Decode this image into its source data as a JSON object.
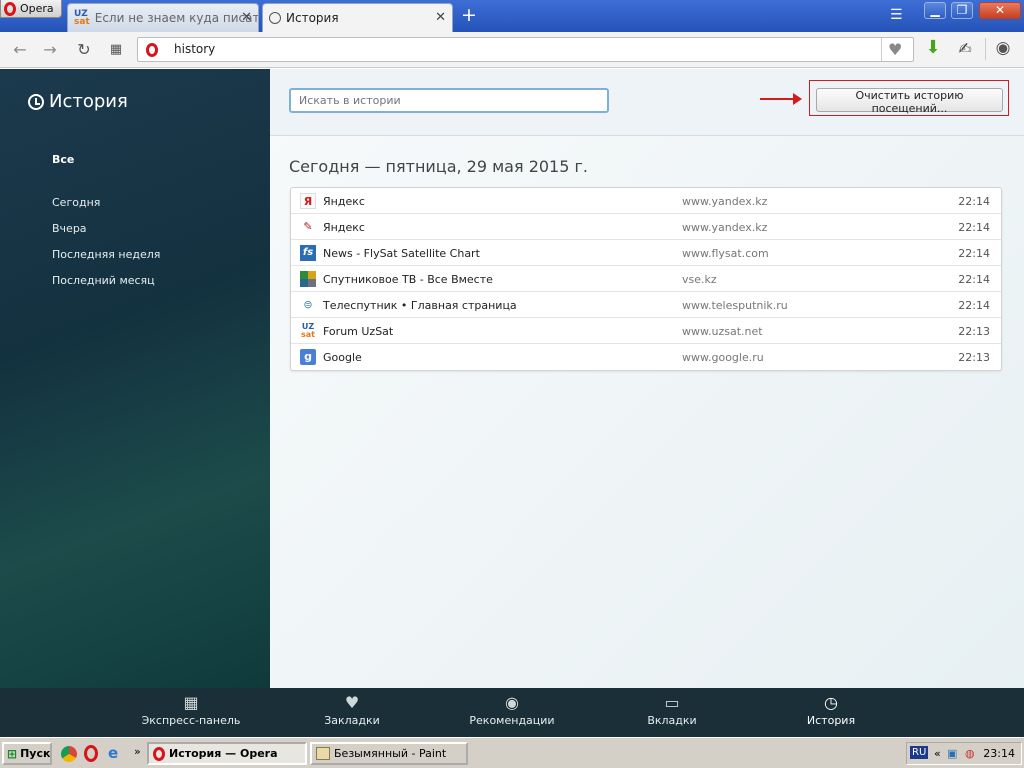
{
  "browser": {
    "menu_label": "Opera",
    "tabs": [
      {
        "title": "Если не знаем куда писать",
        "active": false
      },
      {
        "title": "История",
        "active": true
      }
    ],
    "new_tab": "+",
    "close_glyph": "✕",
    "window_buttons": {
      "minimize": "▁",
      "maximize": "❐",
      "close": "✕"
    }
  },
  "toolbar": {
    "address": "history",
    "icons": [
      "back-icon",
      "forward-icon",
      "reload-icon",
      "speed-dial-icon",
      "heart-icon",
      "download-icon",
      "extension-icon",
      "account-icon"
    ]
  },
  "sidebar": {
    "title": "История",
    "items": [
      {
        "label": "Все",
        "active": true
      },
      {
        "label": "Сегодня"
      },
      {
        "label": "Вчера"
      },
      {
        "label": "Последняя неделя"
      },
      {
        "label": "Последний месяц"
      }
    ]
  },
  "main": {
    "search_placeholder": "Искать в истории",
    "clear_button": "Очистить историю посещений...",
    "date_heading": "Сегодня — пятница, 29 мая 2015 г.",
    "entries": [
      {
        "title": "Яндекс",
        "url": "www.yandex.kz",
        "time": "22:14",
        "icon": "yandex-icon"
      },
      {
        "title": "Яндекс",
        "url": "www.yandex.kz",
        "time": "22:14",
        "icon": "yandex-pen-icon"
      },
      {
        "title": "News - FlySat Satellite Chart",
        "url": "www.flysat.com",
        "time": "22:14",
        "icon": "flysat-icon"
      },
      {
        "title": "Спутниковое ТВ - Все Вместе",
        "url": "vse.kz",
        "time": "22:14",
        "icon": "vse-icon"
      },
      {
        "title": "Телеспутник • Главная страница",
        "url": "www.telesputnik.ru",
        "time": "22:14",
        "icon": "telesputnik-icon"
      },
      {
        "title": "Forum UzSat",
        "url": "www.uzsat.net",
        "time": "22:13",
        "icon": "uzsat-icon"
      },
      {
        "title": "Google",
        "url": "www.google.ru",
        "time": "22:13",
        "icon": "google-icon"
      }
    ]
  },
  "bottom_nav": [
    {
      "label": "Экспресс-панель",
      "icon": "grid-icon"
    },
    {
      "label": "Закладки",
      "icon": "heart-icon"
    },
    {
      "label": "Рекомендации",
      "icon": "eye-icon"
    },
    {
      "label": "Вкладки",
      "icon": "devices-icon"
    },
    {
      "label": "История",
      "icon": "clock-icon"
    }
  ],
  "taskbar": {
    "start": "Пуск",
    "tasks": [
      "История — Opera",
      "Безымянный - Paint"
    ],
    "tray_lang": "RU",
    "clock": "23:14"
  },
  "colors": {
    "sidebar_bg": "#17353f",
    "accent_red": "#d31b1b",
    "opera_red": "#d7141a"
  }
}
